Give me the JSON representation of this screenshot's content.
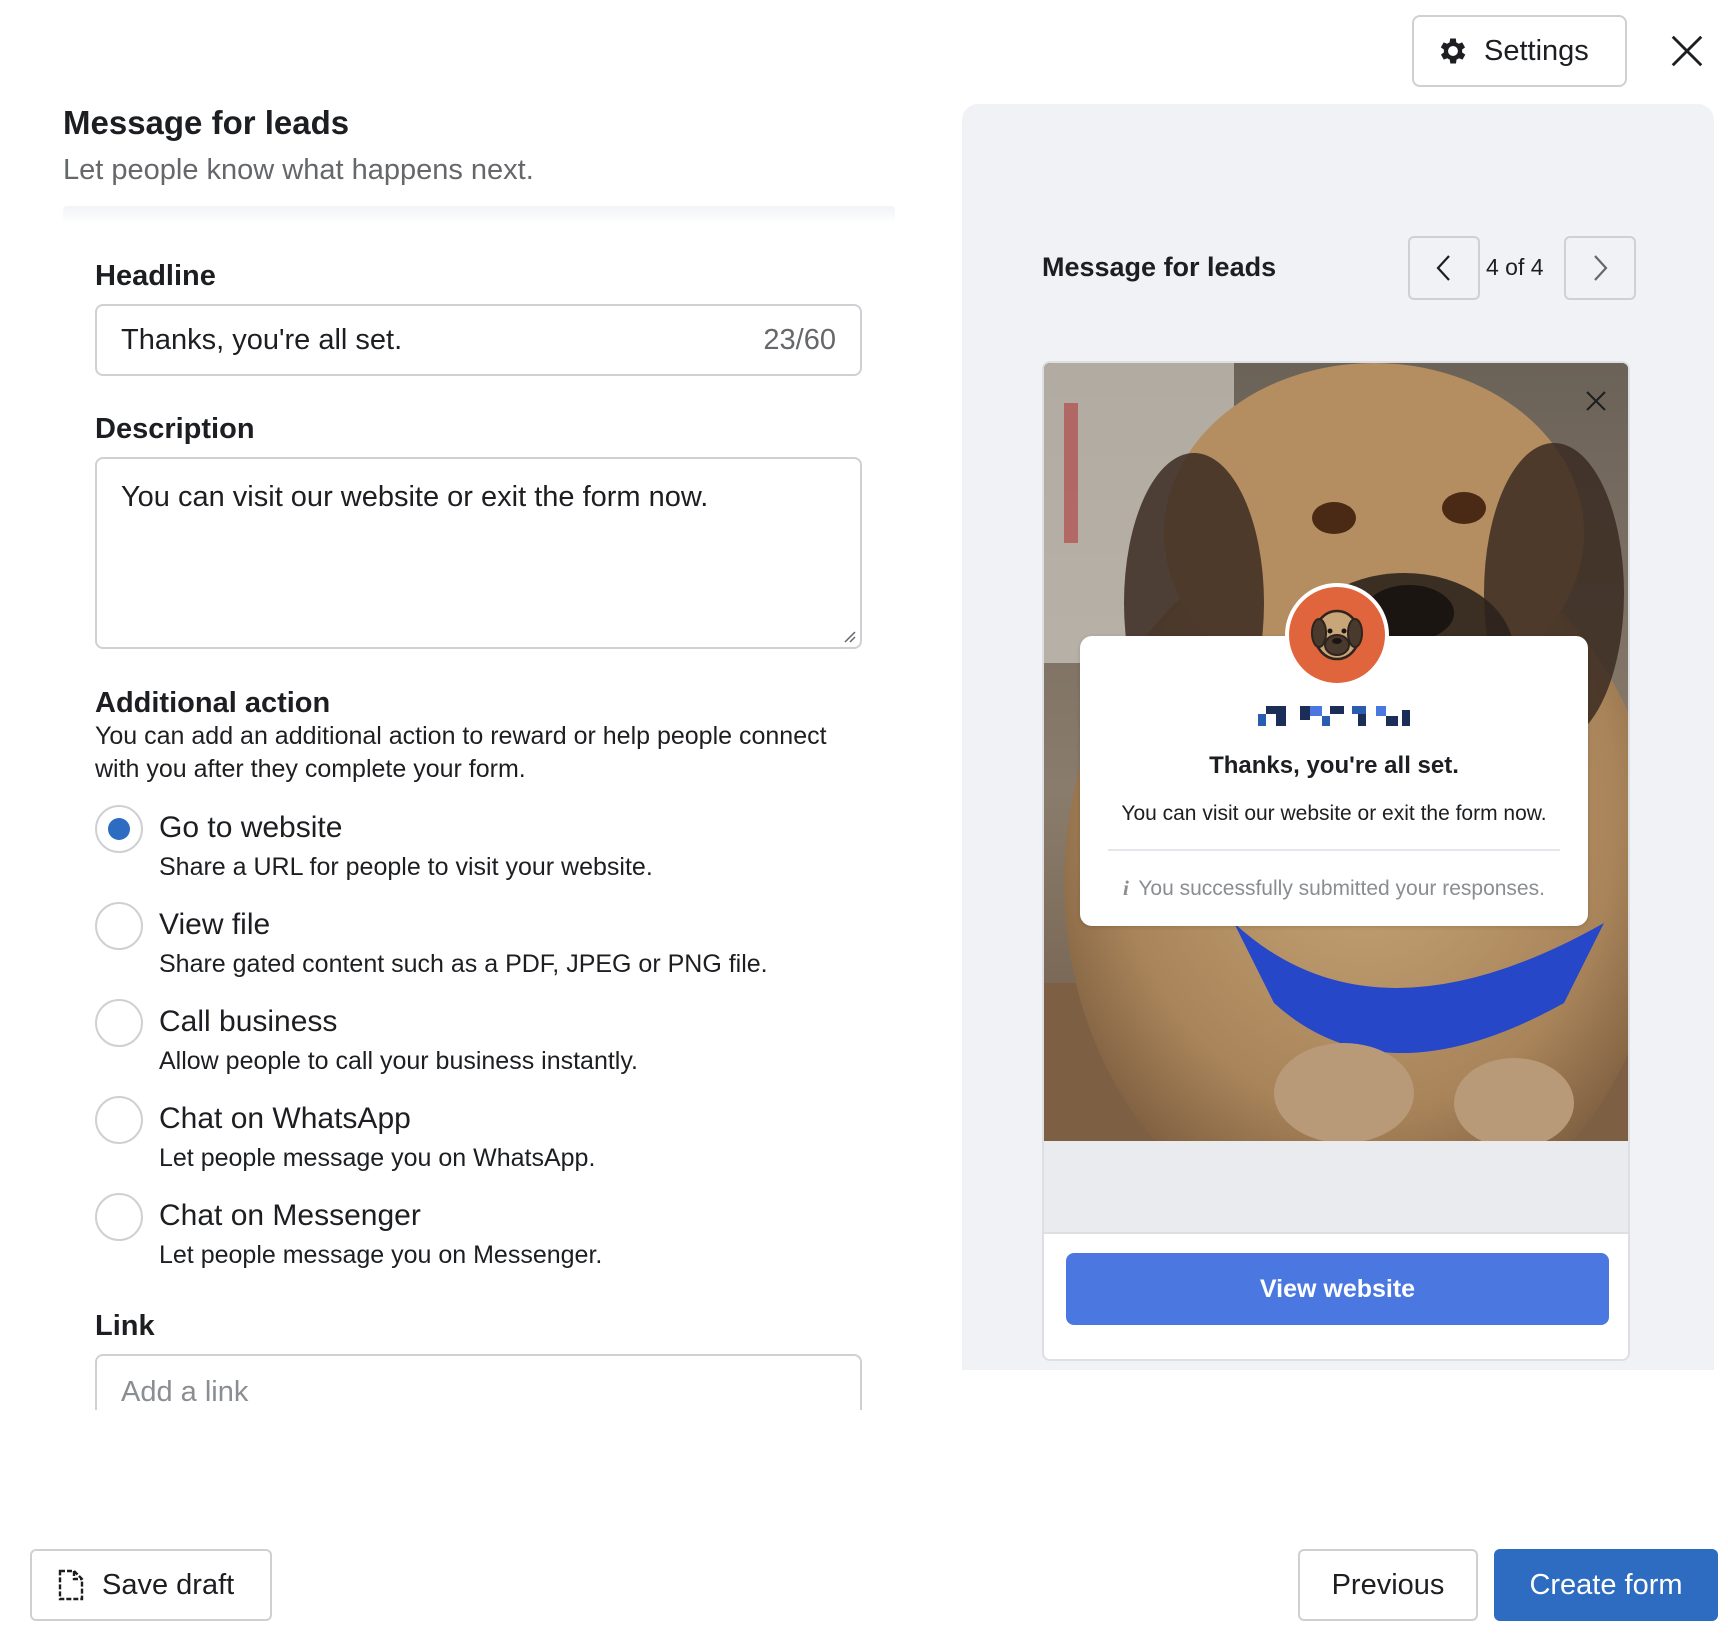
{
  "header": {
    "settings_label": "Settings",
    "settings_icon": "gear-icon",
    "close_icon": "close-icon"
  },
  "section": {
    "title": "Message for leads",
    "subtitle": "Let people know what happens next."
  },
  "headline": {
    "label": "Headline",
    "value": "Thanks, you're all set.",
    "counter": "23/60"
  },
  "description": {
    "label": "Description",
    "value": "You can visit our website or exit the form now."
  },
  "additional_action": {
    "label": "Additional action",
    "description": "You can add an additional action to reward or help people connect with you after they complete your form.",
    "options": [
      {
        "title": "Go to website",
        "desc": "Share a URL for people to visit your website.",
        "checked": true
      },
      {
        "title": "View file",
        "desc": "Share gated content such as a PDF, JPEG or PNG file.",
        "checked": false
      },
      {
        "title": "Call business",
        "desc": "Allow people to call your business instantly.",
        "checked": false
      },
      {
        "title": "Chat on WhatsApp",
        "desc": "Let people message you on WhatsApp.",
        "checked": false
      },
      {
        "title": "Chat on Messenger",
        "desc": "Let people message you on Messenger.",
        "checked": false
      }
    ]
  },
  "link": {
    "label": "Link",
    "placeholder": "Add a link"
  },
  "preview": {
    "title": "Message for leads",
    "page_indicator": "4 of 4",
    "card_headline": "Thanks, you're all set.",
    "card_description": "You can visit our website or exit the form now.",
    "card_note_icon": "i",
    "card_note": "You successfully submitted your responses.",
    "button_label": "View website"
  },
  "footer": {
    "save_draft_label": "Save draft",
    "previous_label": "Previous",
    "create_label": "Create form"
  },
  "colors": {
    "primary": "#2d6cc0",
    "preview_button": "#4a78e0",
    "avatar": "#e0653c",
    "panel_bg": "#f0f2f5"
  }
}
